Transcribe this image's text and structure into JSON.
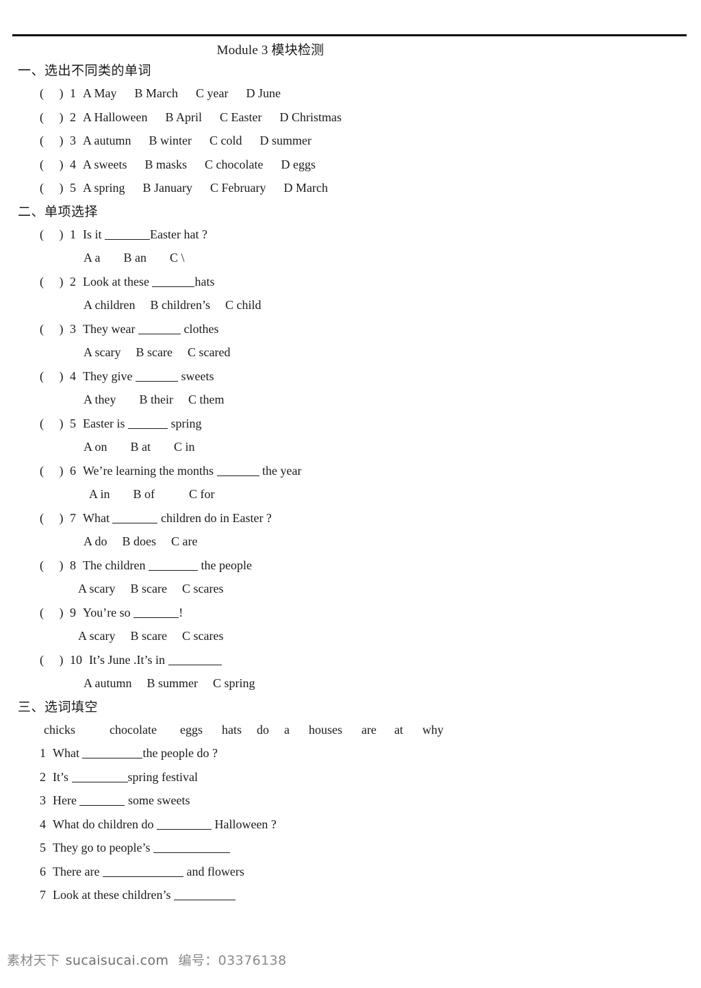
{
  "document": {
    "title": "Module 3  模块检测"
  },
  "sections": [
    {
      "heading": "一、选出不同类的单词",
      "type": "classify",
      "questions": [
        {
          "num": "1",
          "options": [
            "A May",
            "B March",
            "C year",
            "D June"
          ]
        },
        {
          "num": "2",
          "options": [
            "A Halloween",
            "B April",
            "C Easter",
            "D Christmas"
          ]
        },
        {
          "num": "3",
          "options": [
            "A autumn",
            "B winter",
            "C cold",
            "D summer"
          ]
        },
        {
          "num": "4",
          "options": [
            "A sweets",
            "B masks",
            "C chocolate",
            "D eggs"
          ]
        },
        {
          "num": "5",
          "options": [
            "A spring",
            "B January",
            "C February",
            "D March"
          ]
        }
      ]
    },
    {
      "heading": "二、单项选择",
      "type": "multiple-choice",
      "questions": [
        {
          "num": "1",
          "stem_before": "Is it ",
          "stem_after": "Easter hat ?",
          "blank_width": 66,
          "options": [
            "A   a",
            "B   an",
            "C \\"
          ]
        },
        {
          "num": "2",
          "stem_before": "Look at these ",
          "stem_after": "hats",
          "blank_width": 62,
          "options": [
            "A children",
            "B children’s",
            "C child"
          ]
        },
        {
          "num": "3",
          "stem_before": "They wear ",
          "stem_after": " clothes",
          "blank_width": 62,
          "options": [
            "A scary",
            "B scare",
            "C scared"
          ]
        },
        {
          "num": "4",
          "stem_before": "They give ",
          "stem_after": " sweets",
          "blank_width": 62,
          "options": [
            "A they",
            "B their",
            "C them"
          ]
        },
        {
          "num": "5",
          "stem_before": "Easter is ",
          "stem_after": " spring",
          "blank_width": 58,
          "options": [
            "A on",
            "B   at",
            "C in"
          ]
        },
        {
          "num": "6",
          "stem_before": "We’re learning the months ",
          "stem_after": " the year",
          "blank_width": 62,
          "options": [
            "A in",
            "B of",
            "C for"
          ]
        },
        {
          "num": "7",
          "stem_before": "What ",
          "stem_after": " children do in Easter ?",
          "blank_width": 66,
          "options": [
            "A do",
            "B does",
            "C are"
          ]
        },
        {
          "num": "8",
          "stem_before": "The children ",
          "stem_after": " the people",
          "blank_width": 72,
          "options": [
            "A scary",
            "B scare",
            "C scares"
          ]
        },
        {
          "num": "9",
          "stem_before": "You’re so ",
          "stem_after": "!",
          "blank_width": 66,
          "options": [
            "A scary",
            "B scare",
            "C scares"
          ]
        },
        {
          "num": "10",
          "stem_before": "It’s June .It’s in ",
          "stem_after": "",
          "blank_width": 78,
          "options": [
            "A autumn",
            "B summer",
            "C spring"
          ]
        }
      ]
    },
    {
      "heading": "三、选词填空",
      "type": "word-bank",
      "word_bank": [
        "chicks",
        "chocolate",
        "eggs",
        "hats",
        "do",
        "a",
        "houses",
        "are",
        "at",
        "why"
      ],
      "questions": [
        {
          "num": "1",
          "before": "What ",
          "after": "the people do ?",
          "blank_width": 88
        },
        {
          "num": "2",
          "before": "It’s ",
          "after": "spring festival",
          "blank_width": 82
        },
        {
          "num": "3",
          "before": "Here ",
          "after": " some sweets",
          "blank_width": 66
        },
        {
          "num": "4",
          "before": "What do children do ",
          "after": " Halloween ?",
          "blank_width": 80
        },
        {
          "num": "5",
          "before": "They go to people’s ",
          "after": "",
          "blank_width": 112
        },
        {
          "num": "6",
          "before": "There are ",
          "after": " and flowers",
          "blank_width": 118
        },
        {
          "num": "7",
          "before": "Look at these children’s ",
          "after": "",
          "blank_width": 90
        }
      ]
    }
  ],
  "footer": {
    "brand": "素材天下",
    "site": "sucaisucai.com",
    "id_label": "编号：",
    "id_value": "03376138"
  }
}
